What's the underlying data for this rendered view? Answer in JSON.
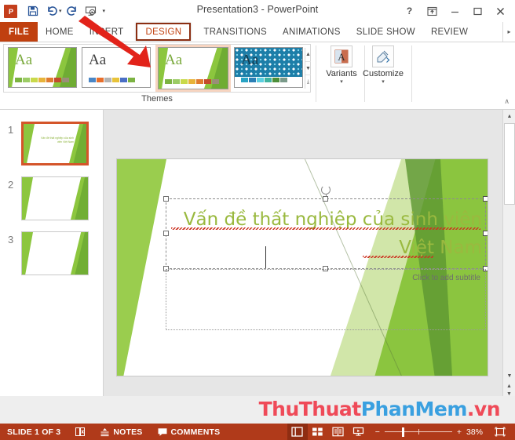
{
  "window": {
    "title": "Presentation3 - PowerPoint",
    "app_logo": "powerpoint-logo",
    "quick_access": [
      {
        "name": "save-icon",
        "label": "Save"
      },
      {
        "name": "undo-icon",
        "label": "Undo"
      },
      {
        "name": "redo-icon",
        "label": "Redo"
      },
      {
        "name": "start-slideshow-icon",
        "label": "Start From Beginning"
      },
      {
        "name": "customize-qat-icon",
        "label": "Customize Quick Access Toolbar"
      }
    ],
    "controls": [
      {
        "name": "help-button",
        "glyph": "?"
      },
      {
        "name": "ribbon-display-options-button",
        "glyph": "ribbon-options-icon"
      },
      {
        "name": "minimize-button",
        "glyph": "minimize-icon"
      },
      {
        "name": "maximize-button",
        "glyph": "maximize-icon"
      },
      {
        "name": "close-button",
        "glyph": "close-icon"
      }
    ]
  },
  "ribbon": {
    "file_tab": "FILE",
    "tabs": [
      {
        "label": "HOME",
        "selected": false
      },
      {
        "label": "INSERT",
        "selected": false
      },
      {
        "label": "DESIGN",
        "selected": true
      },
      {
        "label": "TRANSITIONS",
        "selected": false
      },
      {
        "label": "ANIMATIONS",
        "selected": false
      },
      {
        "label": "SLIDE SHOW",
        "selected": false
      },
      {
        "label": "REVIEW",
        "selected": false
      }
    ],
    "overflow_glyph": "▸",
    "themes_group_label": "Themes",
    "themes": [
      {
        "name": "theme-facet-green",
        "aa": "Aa",
        "selected": false,
        "style": "green",
        "swatches": [
          "#7cb342",
          "#9ccc65",
          "#c9d94a",
          "#e8b33a",
          "#e07b2e",
          "#c44b2c",
          "#9a8e78"
        ]
      },
      {
        "name": "theme-white",
        "aa": "Aa",
        "selected": false,
        "style": "plain",
        "swatches": [
          "#4a86c5",
          "#e86f2b",
          "#b3b3b3",
          "#e8c33a",
          "#4a6fc5",
          "#7cb342"
        ]
      },
      {
        "name": "theme-facet-green-applied",
        "aa": "Aa",
        "selected": true,
        "style": "green",
        "swatches": [
          "#7cb342",
          "#9ccc65",
          "#c9d94a",
          "#e8b33a",
          "#e07b2e",
          "#c44b2c",
          "#9a8e78"
        ]
      },
      {
        "name": "theme-wisp-pattern",
        "aa": "Aa",
        "selected": false,
        "style": "pattern",
        "swatches": [
          "#29a3c4",
          "#2b7fb5",
          "#5ccfe0",
          "#3fb3a0",
          "#4e8f3a",
          "#7a9a8a"
        ]
      }
    ],
    "theme_scroll": {
      "up": "▲",
      "down": "▼",
      "more": "⤓"
    },
    "buttons": [
      {
        "name": "variants-button",
        "label": "Variants",
        "icon": "variants-icon",
        "caret": "▾"
      },
      {
        "name": "customize-button",
        "label": "Customize",
        "icon": "customize-icon",
        "caret": "▾"
      }
    ],
    "collapse_glyph": "∧"
  },
  "slide_pane": {
    "slides": [
      {
        "number": "1",
        "active": true,
        "title": "Vấn đề thất nghiệp của sinh viên Việt Nam"
      },
      {
        "number": "2",
        "active": false,
        "title": ""
      },
      {
        "number": "3",
        "active": false,
        "title": ""
      }
    ]
  },
  "slide": {
    "title_text": "Vấn đề thất nghiệp của sinh viên",
    "title_text_line2": "Việt Nam",
    "subtitle_placeholder": "Click to add subtitle"
  },
  "watermark": {
    "part1": "ThuThuat",
    "part2": "PhanMem",
    "part3": ".vn"
  },
  "status_bar": {
    "slide_count_label": "SLIDE 1 OF 3",
    "language_icon": "spellcheck-icon",
    "notes_label": "NOTES",
    "notes_icon": "notes-icon",
    "comments_label": "COMMENTS",
    "comments_icon": "comments-icon",
    "views": [
      {
        "name": "normal-view-button",
        "active": true,
        "icon": "normal-view-icon"
      },
      {
        "name": "slide-sorter-button",
        "active": false,
        "icon": "slide-sorter-icon"
      },
      {
        "name": "reading-view-button",
        "active": false,
        "icon": "reading-view-icon"
      },
      {
        "name": "slideshow-button",
        "active": false,
        "icon": "slideshow-icon"
      }
    ],
    "zoom_out": "−",
    "zoom_in": "+",
    "zoom_level": "38%",
    "fit_button": "fit-slide-icon"
  },
  "annotation": {
    "arrow": "red-arrow-pointing-to-theme",
    "color": "#e2231a"
  },
  "colors": {
    "ribbon_accent": "#c0400f",
    "status_bar": "#b03a1a",
    "theme_green": "#8cc63e",
    "title_text_green": "#9ab93f",
    "selected_theme_highlight": "#f7d4c0"
  }
}
